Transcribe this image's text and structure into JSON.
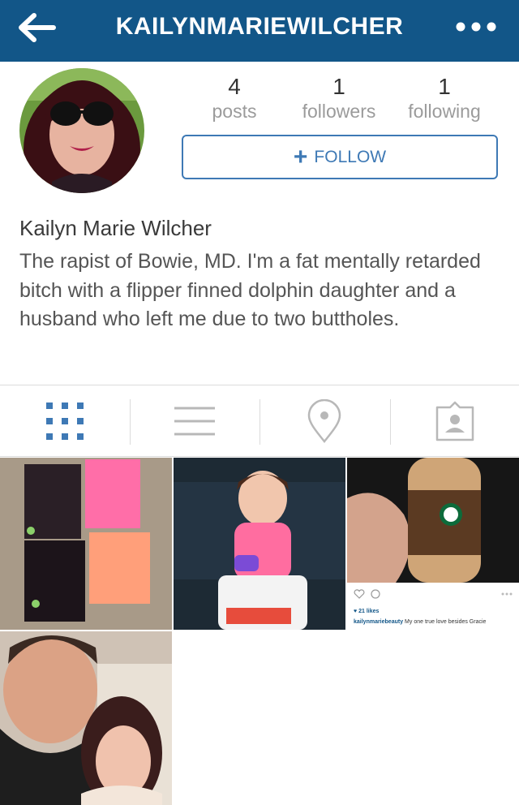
{
  "header": {
    "username": "KAILYNMARIEWILCHER",
    "back_icon": "arrow-left-icon",
    "more_icon": "more-horizontal-icon",
    "bg_color": "#125688"
  },
  "stats": [
    {
      "value": "4",
      "label": "posts"
    },
    {
      "value": "1",
      "label": "followers"
    },
    {
      "value": "1",
      "label": "following"
    }
  ],
  "follow_button": {
    "label": "FOLLOW",
    "color": "#3e79b5"
  },
  "profile": {
    "display_name": "Kailyn Marie Wilcher",
    "bio": "The rapist of Bowie, MD. I'm a fat mentally retarded bitch with a flipper finned dolphin daughter and a husband who left me due to two buttholes."
  },
  "tabs": [
    {
      "icon": "grid-icon",
      "active": true
    },
    {
      "icon": "list-icon",
      "active": false
    },
    {
      "icon": "location-pin-icon",
      "active": false
    },
    {
      "icon": "tagged-user-icon",
      "active": false
    }
  ],
  "photos": [
    {
      "subject": "shorts-laid-out"
    },
    {
      "subject": "baby-on-ride-on-toy"
    },
    {
      "subject": "frappuccino-bottle-screenshot",
      "embedded_post": {
        "likes": "♥ 21 likes",
        "username": "kailynmariebeauty",
        "caption": "My one true love besides Gracie"
      }
    },
    {
      "subject": "couple-selfie"
    }
  ]
}
